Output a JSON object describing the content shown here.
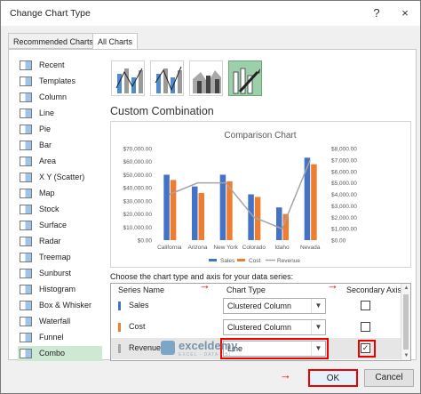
{
  "window": {
    "title": "Change Chart Type",
    "help_label": "?",
    "close_label": "×"
  },
  "tabs": [
    {
      "label": "Recommended Charts",
      "active": false
    },
    {
      "label": "All Charts",
      "active": true
    }
  ],
  "chart_types": [
    {
      "label": "Recent"
    },
    {
      "label": "Templates"
    },
    {
      "label": "Column"
    },
    {
      "label": "Line"
    },
    {
      "label": "Pie"
    },
    {
      "label": "Bar"
    },
    {
      "label": "Area"
    },
    {
      "label": "X Y (Scatter)"
    },
    {
      "label": "Map"
    },
    {
      "label": "Stock"
    },
    {
      "label": "Surface"
    },
    {
      "label": "Radar"
    },
    {
      "label": "Treemap"
    },
    {
      "label": "Sunburst"
    },
    {
      "label": "Histogram"
    },
    {
      "label": "Box & Whisker"
    },
    {
      "label": "Waterfall"
    },
    {
      "label": "Funnel"
    },
    {
      "label": "Combo",
      "selected": true
    }
  ],
  "subtype_icons": [
    "clustered-column-line-icon",
    "clustered-column-line-secondary-axis-icon",
    "stacked-area-clustered-column-icon",
    "custom-combination-icon"
  ],
  "subtitle": "Custom Combination",
  "chart_data": {
    "type": "bar",
    "title": "Comparison Chart",
    "categories": [
      "California",
      "Arizona",
      "New York",
      "Colorado",
      "Idaho",
      "Nevada"
    ],
    "series": [
      {
        "name": "Sales",
        "type": "bar",
        "axis": "primary",
        "color": "#4472c4",
        "values": [
          50000,
          41000,
          50000,
          35000,
          25000,
          63000
        ]
      },
      {
        "name": "Cost",
        "type": "bar",
        "axis": "primary",
        "color": "#ed7d31",
        "values": [
          46000,
          36000,
          45000,
          33000,
          20000,
          58000
        ]
      },
      {
        "name": "Revenue",
        "type": "line",
        "axis": "secondary",
        "color": "#a5a5a5",
        "values": [
          4000,
          5000,
          5000,
          2000,
          1000,
          7000
        ]
      }
    ],
    "ylim": [
      0,
      70000
    ],
    "y2lim": [
      0,
      8000
    ],
    "yticks": [
      "$0.00",
      "$10,000.00",
      "$20,000.00",
      "$30,000.00",
      "$40,000.00",
      "$50,000.00",
      "$60,000.00",
      "$70,000.00"
    ],
    "y2ticks": [
      "$0.00",
      "$1,000.00",
      "$2,000.00",
      "$3,000.00",
      "$4,000.00",
      "$5,000.00",
      "$6,000.00",
      "$7,000.00",
      "$8,000.00"
    ],
    "legend": "bottom"
  },
  "series_prompt": "Choose the chart type and axis for your data series:",
  "table": {
    "headers": {
      "name": "Series Name",
      "type": "Chart Type",
      "axis": "Secondary Axis"
    },
    "rows": [
      {
        "name": "Sales",
        "chart_type": "Clustered Column",
        "secondary": false,
        "color": "#4472c4"
      },
      {
        "name": "Cost",
        "chart_type": "Clustered Column",
        "secondary": false,
        "color": "#ed7d31"
      },
      {
        "name": "Revenue",
        "chart_type": "Line",
        "secondary": true,
        "color": "#a5a5a5"
      }
    ]
  },
  "buttons": {
    "ok": "OK",
    "cancel": "Cancel"
  },
  "watermark": {
    "name": "exceldemy",
    "tagline": "EXCEL · DATA · BI"
  }
}
